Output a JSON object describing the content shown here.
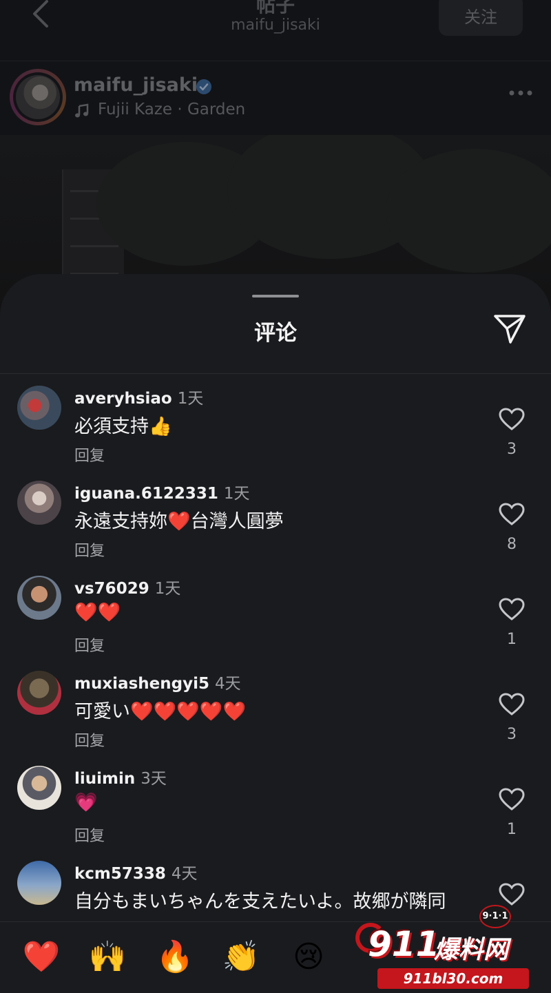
{
  "header": {
    "title": "帖子",
    "subtitle": "maifu_jisaki",
    "follow_label": "关注"
  },
  "post": {
    "author": "maifu_jisaki",
    "music": "Fujii Kaze · Garden"
  },
  "sheet": {
    "title": "评论"
  },
  "comments": [
    {
      "user": "averyhsiao",
      "time": "1天",
      "text": "必須支持👍",
      "reply": "回复",
      "likes": "3"
    },
    {
      "user": "iguana.6122331",
      "time": "1天",
      "text": "永遠支持妳❤️台灣人圓夢",
      "reply": "回复",
      "likes": "8"
    },
    {
      "user": "vs76029",
      "time": "1天",
      "text": "❤️❤️",
      "reply": "回复",
      "likes": "1"
    },
    {
      "user": "muxiashengyi5",
      "time": "4天",
      "text": "可愛い❤️❤️❤️❤️❤️",
      "reply": "回复",
      "likes": "3"
    },
    {
      "user": "liuimin",
      "time": "3天",
      "text": "💗",
      "reply": "回复",
      "likes": "1"
    },
    {
      "user": "kcm57338",
      "time": "4天",
      "text": "自分もまいちゃんを支えたいよ。故郷が隣同",
      "reply": "",
      "likes": ""
    }
  ],
  "emoji_bar": [
    "❤️",
    "🙌",
    "🔥",
    "👏",
    "😢"
  ],
  "watermark": {
    "brand": "911",
    "name": "爆料网",
    "url": "911bl30.com",
    "badge": "9·1·1"
  },
  "colors": {
    "sheet_bg": "#1a1b1e",
    "text_primary": "#f2f2f3",
    "text_secondary": "#9a9ca0",
    "watermark_red": "#c4161c",
    "verified_blue": "#3d6fa8"
  }
}
